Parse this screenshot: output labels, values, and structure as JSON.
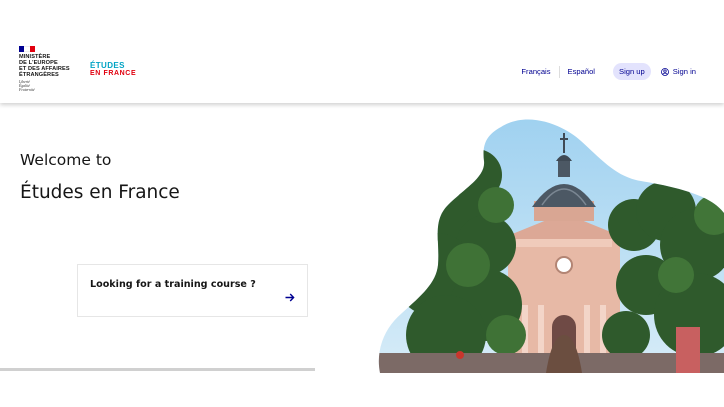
{
  "header": {
    "ministry": "MINISTÈRE\nDE L'EUROPE\nET DES AFFAIRES\nÉTRANGÈRES",
    "motto": "Liberté\nÉgalité\nFraternité",
    "brand_line1": "ÉTUDES",
    "brand_line2": "EN FRANCE",
    "nav": {
      "lang_fr": "Français",
      "lang_es": "Español",
      "signup": "Sign up",
      "signin": "Sign in"
    }
  },
  "main": {
    "welcome": "Welcome to",
    "title": "Études en France",
    "training_card": {
      "label": "Looking for a training course ?"
    },
    "carousel_progress": 1.0
  },
  "colors": {
    "primary_blue": "#000091",
    "flag_blue": "#000091",
    "flag_white": "#ffffff",
    "flag_red": "#e1000f",
    "brand_cyan": "#00a3c4",
    "brand_red": "#e1000f"
  },
  "icons": {
    "signin": "user-circle-icon",
    "arrow": "arrow-right-icon"
  }
}
